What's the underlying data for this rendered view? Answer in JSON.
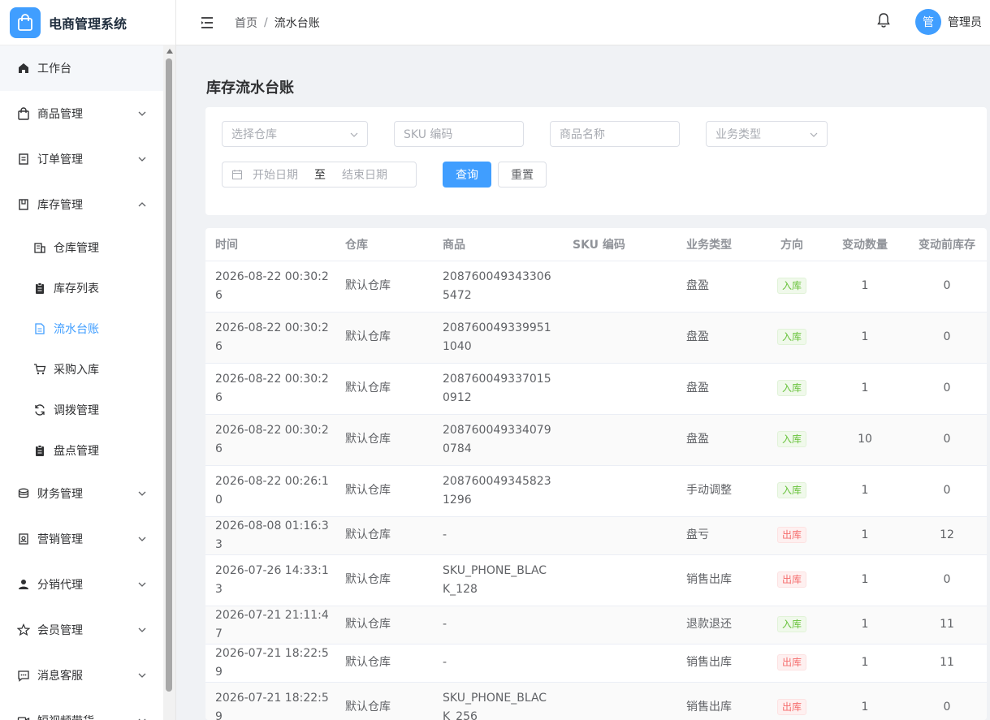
{
  "app": {
    "title": "电商管理系统"
  },
  "header": {
    "breadcrumb_home": "首页",
    "breadcrumb_sep": "/",
    "breadcrumb_current": "流水台账",
    "avatar_text": "管",
    "username": "管理员"
  },
  "sidebar": {
    "items": [
      {
        "label": "工作台",
        "icon": "home-icon"
      },
      {
        "label": "商品管理",
        "icon": "shopping-bag-icon"
      },
      {
        "label": "订单管理",
        "icon": "document-icon"
      },
      {
        "label": "库存管理",
        "icon": "inventory-icon"
      },
      {
        "label": "财务管理",
        "icon": "coins-icon"
      },
      {
        "label": "营销管理",
        "icon": "marketing-icon"
      },
      {
        "label": "分销代理",
        "icon": "user-icon"
      },
      {
        "label": "会员管理",
        "icon": "star-icon"
      },
      {
        "label": "消息客服",
        "icon": "chat-icon"
      },
      {
        "label": "短视频带货",
        "icon": "video-icon"
      }
    ],
    "inventory_sub": [
      {
        "label": "仓库管理",
        "icon": "warehouse-icon"
      },
      {
        "label": "库存列表",
        "icon": "clipboard-icon"
      },
      {
        "label": "流水台账",
        "icon": "ledger-icon"
      },
      {
        "label": "采购入库",
        "icon": "cart-icon"
      },
      {
        "label": "调拨管理",
        "icon": "refresh-icon"
      },
      {
        "label": "盘点管理",
        "icon": "clipboard-icon"
      }
    ]
  },
  "page": {
    "title": "库存流水台账"
  },
  "filters": {
    "warehouse_placeholder": "选择仓库",
    "sku_placeholder": "SKU 编码",
    "product_placeholder": "商品名称",
    "type_placeholder": "业务类型",
    "start_date": "开始日期",
    "date_sep": "至",
    "end_date": "结束日期",
    "query_label": "查询",
    "reset_label": "重置"
  },
  "table": {
    "headers": [
      "时间",
      "仓库",
      "商品",
      "SKU 编码",
      "业务类型",
      "方向",
      "变动数量",
      "变动前库存"
    ],
    "rows": [
      {
        "time": "2026-08-22 00:30:26",
        "warehouse": "默认仓库",
        "product": "2087600493433065472",
        "sku": "",
        "type": "盘盈",
        "direction": "入库",
        "dir": "in",
        "qty": "1",
        "before": "0"
      },
      {
        "time": "2026-08-22 00:30:26",
        "warehouse": "默认仓库",
        "product": "2087600493399511040",
        "sku": "",
        "type": "盘盈",
        "direction": "入库",
        "dir": "in",
        "qty": "1",
        "before": "0"
      },
      {
        "time": "2026-08-22 00:30:26",
        "warehouse": "默认仓库",
        "product": "2087600493370150912",
        "sku": "",
        "type": "盘盈",
        "direction": "入库",
        "dir": "in",
        "qty": "1",
        "before": "0"
      },
      {
        "time": "2026-08-22 00:30:26",
        "warehouse": "默认仓库",
        "product": "2087600493340790784",
        "sku": "",
        "type": "盘盈",
        "direction": "入库",
        "dir": "in",
        "qty": "10",
        "before": "0"
      },
      {
        "time": "2026-08-22 00:26:10",
        "warehouse": "默认仓库",
        "product": "2087600493458231296",
        "sku": "",
        "type": "手动调整",
        "direction": "入库",
        "dir": "in",
        "qty": "1",
        "before": "0"
      },
      {
        "time": "2026-08-08 01:16:33",
        "warehouse": "默认仓库",
        "product": "-",
        "sku": "",
        "type": "盘亏",
        "direction": "出库",
        "dir": "out",
        "qty": "1",
        "before": "12"
      },
      {
        "time": "2026-07-26 14:33:13",
        "warehouse": "默认仓库",
        "product": "SKU_PHONE_BLACK_128",
        "sku": "",
        "type": "销售出库",
        "direction": "出库",
        "dir": "out",
        "qty": "1",
        "before": "0"
      },
      {
        "time": "2026-07-21 21:11:47",
        "warehouse": "默认仓库",
        "product": "-",
        "sku": "",
        "type": "退款退还",
        "direction": "入库",
        "dir": "in",
        "qty": "1",
        "before": "11"
      },
      {
        "time": "2026-07-21 18:22:59",
        "warehouse": "默认仓库",
        "product": "-",
        "sku": "",
        "type": "销售出库",
        "direction": "出库",
        "dir": "out",
        "qty": "1",
        "before": "11"
      },
      {
        "time": "2026-07-21 18:22:59",
        "warehouse": "默认仓库",
        "product": "SKU_PHONE_BLACK_256",
        "sku": "",
        "type": "销售出库",
        "direction": "出库",
        "dir": "out",
        "qty": "1",
        "before": "0"
      }
    ]
  }
}
